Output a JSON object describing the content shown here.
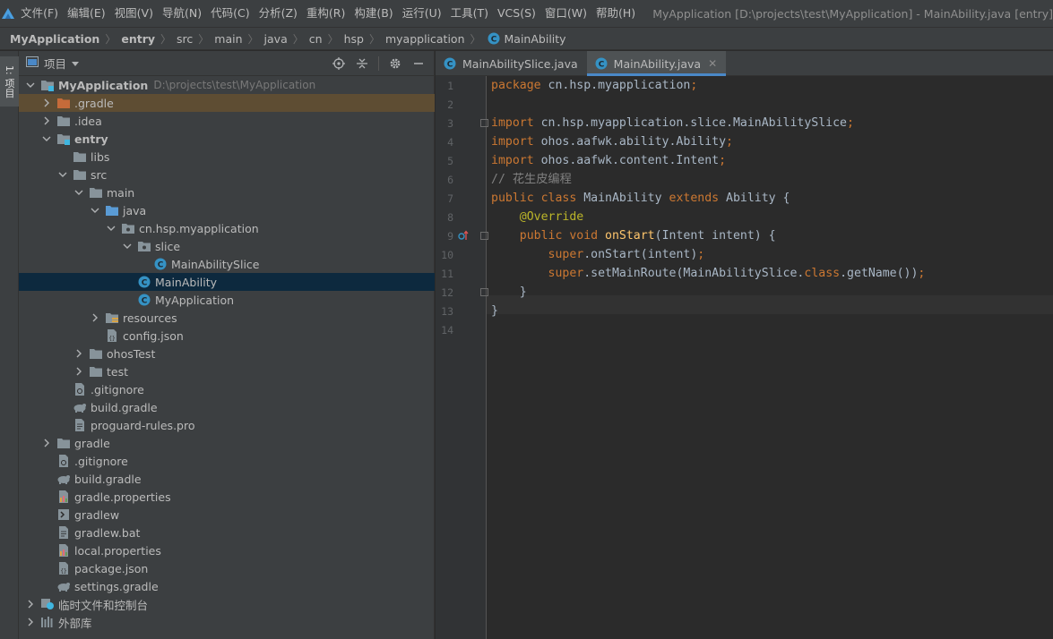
{
  "menubar": {
    "items": [
      "文件(F)",
      "编辑(E)",
      "视图(V)",
      "导航(N)",
      "代码(C)",
      "分析(Z)",
      "重构(R)",
      "构建(B)",
      "运行(U)",
      "工具(T)",
      "VCS(S)",
      "窗口(W)",
      "帮助(H)"
    ],
    "window_title": "MyApplication [D:\\projects\\test\\MyApplication] - MainAbility.java [entry]"
  },
  "breadcrumb": [
    "MyApplication",
    "entry",
    "src",
    "main",
    "java",
    "cn",
    "hsp",
    "myapplication",
    "MainAbility"
  ],
  "left_stripe": {
    "label": "1: 项目"
  },
  "project_panel": {
    "title": "项目",
    "tree": [
      {
        "label": "MyApplication",
        "path": "D:\\projects\\test\\MyApplication",
        "icon": "module-folder-icon",
        "expanded": true,
        "depth": 0
      },
      {
        "label": ".gradle",
        "icon": "folder-orange-icon",
        "expanded": false,
        "depth": 1,
        "highlight": true
      },
      {
        "label": ".idea",
        "icon": "folder-icon",
        "expanded": false,
        "depth": 1
      },
      {
        "label": "entry",
        "icon": "module-folder-icon",
        "expanded": true,
        "depth": 1,
        "bold": true
      },
      {
        "label": "libs",
        "icon": "folder-icon",
        "depth": 2
      },
      {
        "label": "src",
        "icon": "folder-icon",
        "expanded": true,
        "depth": 2
      },
      {
        "label": "main",
        "icon": "folder-icon",
        "expanded": true,
        "depth": 3
      },
      {
        "label": "java",
        "icon": "folder-blue-icon",
        "expanded": true,
        "depth": 4
      },
      {
        "label": "cn.hsp.myapplication",
        "icon": "package-icon",
        "expanded": true,
        "depth": 5
      },
      {
        "label": "slice",
        "icon": "package-icon",
        "expanded": true,
        "depth": 6
      },
      {
        "label": "MainAbilitySlice",
        "icon": "class-icon",
        "depth": 7
      },
      {
        "label": "MainAbility",
        "icon": "class-icon",
        "depth": 6,
        "selected": true
      },
      {
        "label": "MyApplication",
        "icon": "class-icon",
        "depth": 6
      },
      {
        "label": "resources",
        "icon": "resources-folder-icon",
        "expanded": false,
        "depth": 4
      },
      {
        "label": "config.json",
        "icon": "json-file-icon",
        "depth": 4
      },
      {
        "label": "ohosTest",
        "icon": "folder-icon",
        "expanded": false,
        "depth": 3
      },
      {
        "label": "test",
        "icon": "folder-icon",
        "expanded": false,
        "depth": 3
      },
      {
        "label": ".gitignore",
        "icon": "gitignore-file-icon",
        "depth": 2
      },
      {
        "label": "build.gradle",
        "icon": "gradle-file-icon",
        "depth": 2
      },
      {
        "label": "proguard-rules.pro",
        "icon": "text-file-icon",
        "depth": 2
      },
      {
        "label": "gradle",
        "icon": "folder-icon",
        "expanded": false,
        "depth": 1
      },
      {
        "label": ".gitignore",
        "icon": "gitignore-file-icon",
        "depth": 1
      },
      {
        "label": "build.gradle",
        "icon": "gradle-file-icon",
        "depth": 1
      },
      {
        "label": "gradle.properties",
        "icon": "properties-file-icon",
        "depth": 1
      },
      {
        "label": "gradlew",
        "icon": "shell-file-icon",
        "depth": 1
      },
      {
        "label": "gradlew.bat",
        "icon": "text-file-icon",
        "depth": 1
      },
      {
        "label": "local.properties",
        "icon": "properties-file-icon",
        "depth": 1
      },
      {
        "label": "package.json",
        "icon": "json-file-icon",
        "depth": 1
      },
      {
        "label": "settings.gradle",
        "icon": "gradle-file-icon",
        "depth": 1
      },
      {
        "label": "临时文件和控制台",
        "icon": "scratches-icon",
        "expanded": false,
        "depth": 0
      },
      {
        "label": "外部库",
        "icon": "library-icon",
        "expanded": false,
        "depth": 0
      }
    ]
  },
  "editor": {
    "tabs": [
      {
        "label": "MainAbilitySlice.java",
        "active": false
      },
      {
        "label": "MainAbility.java",
        "active": true
      }
    ],
    "current_line": 14,
    "lines": [
      [
        [
          "kw",
          "package "
        ],
        [
          "t",
          "cn.hsp.myapplication"
        ],
        [
          "kw",
          ";"
        ]
      ],
      [],
      [
        [
          "kw",
          "import "
        ],
        [
          "t",
          "cn.hsp.myapplication.slice.MainAbilitySlice"
        ],
        [
          "kw",
          ";"
        ]
      ],
      [
        [
          "kw",
          "import "
        ],
        [
          "t",
          "ohos.aafwk.ability.Ability"
        ],
        [
          "kw",
          ";"
        ]
      ],
      [
        [
          "kw",
          "import "
        ],
        [
          "t",
          "ohos.aafwk.content.Intent"
        ],
        [
          "kw",
          ";"
        ]
      ],
      [
        [
          "cmt",
          "// 花生皮编程"
        ]
      ],
      [
        [
          "kw",
          "public class "
        ],
        [
          "t",
          "MainAbility "
        ],
        [
          "kw",
          "extends "
        ],
        [
          "t",
          "Ability {"
        ]
      ],
      [
        [
          "t",
          "    "
        ],
        [
          "ann",
          "@Override"
        ]
      ],
      [
        [
          "t",
          "    "
        ],
        [
          "kw",
          "public void "
        ],
        [
          "fn",
          "onStart"
        ],
        [
          "t",
          "(Intent intent) {"
        ]
      ],
      [
        [
          "t",
          "        "
        ],
        [
          "kw",
          "super"
        ],
        [
          "t",
          ".onStart(intent)"
        ],
        [
          "kw",
          ";"
        ]
      ],
      [
        [
          "t",
          "        "
        ],
        [
          "kw",
          "super"
        ],
        [
          "t",
          ".setMainRoute(MainAbilitySlice."
        ],
        [
          "kw",
          "class"
        ],
        [
          "t",
          ".getName())"
        ],
        [
          "kw",
          ";"
        ]
      ],
      [
        [
          "t",
          "    }"
        ]
      ],
      [
        [
          "t",
          "}"
        ]
      ],
      []
    ]
  },
  "colors": {
    "accent": "#4a88c7",
    "keyword": "#cc7832",
    "annotation": "#bbb529",
    "method": "#ffc66d",
    "comment": "#808080",
    "text": "#a9b7c6",
    "selection": "#0d293e"
  }
}
